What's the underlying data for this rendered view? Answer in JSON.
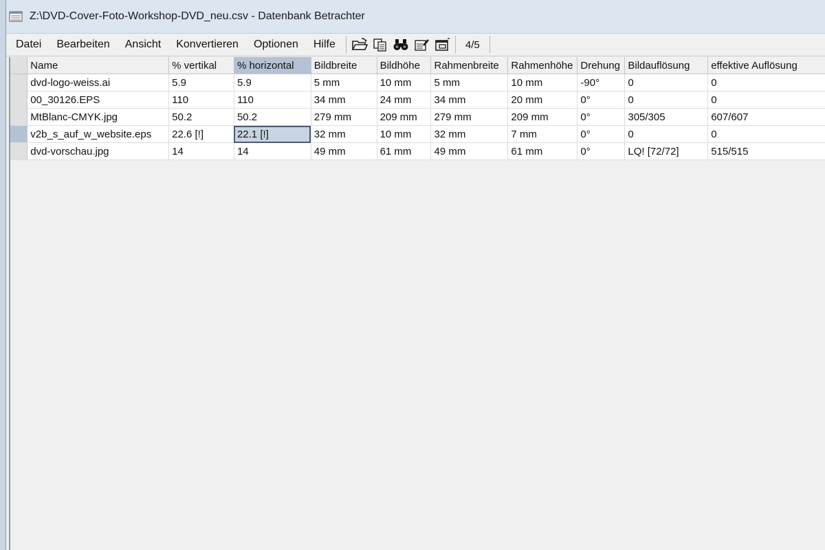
{
  "window": {
    "title": "Z:\\DVD-Cover-Foto-Workshop-DVD_neu.csv - Datenbank Betrachter"
  },
  "menu": [
    "Datei",
    "Bearbeiten",
    "Ansicht",
    "Konvertieren",
    "Optionen",
    "Hilfe"
  ],
  "toolbar": {
    "icons": [
      "open-folder-icon",
      "copy-icon",
      "binoculars-icon",
      "edit-icon",
      "window-icon"
    ],
    "counter": "4/5"
  },
  "table": {
    "columns": [
      "Name",
      "% vertikal",
      "% horizontal",
      "Bildbreite",
      "Bildhöhe",
      "Rahmenbreite",
      "Rahmenhöhe",
      "Drehung",
      "Bildauflösung",
      "effektive Auflösung"
    ],
    "selected_column": 2,
    "current_row": 3,
    "rows": [
      [
        "dvd-logo-weiss.ai",
        "5.9",
        "5.9",
        "5 mm",
        "10 mm",
        "5 mm",
        "10 mm",
        "-90°",
        "0",
        "0"
      ],
      [
        "00_30126.EPS",
        "110",
        "110",
        "34 mm",
        "24 mm",
        "34 mm",
        "20 mm",
        "0°",
        "0",
        "0"
      ],
      [
        "MtBlanc-CMYK.jpg",
        "50.2",
        "50.2",
        "279 mm",
        "209 mm",
        "279 mm",
        "209 mm",
        "0°",
        "305/305",
        "607/607"
      ],
      [
        "v2b_s_auf_w_website.eps",
        "22.6 [!]",
        "22.1 [!]",
        "32 mm",
        "10 mm",
        "32 mm",
        "7 mm",
        "0°",
        "0",
        "0"
      ],
      [
        "dvd-vorschau.jpg",
        "14",
        "14",
        "49 mm",
        "61 mm",
        "49 mm",
        "61 mm",
        "0°",
        "LQ! [72/72]",
        "515/515"
      ]
    ]
  }
}
